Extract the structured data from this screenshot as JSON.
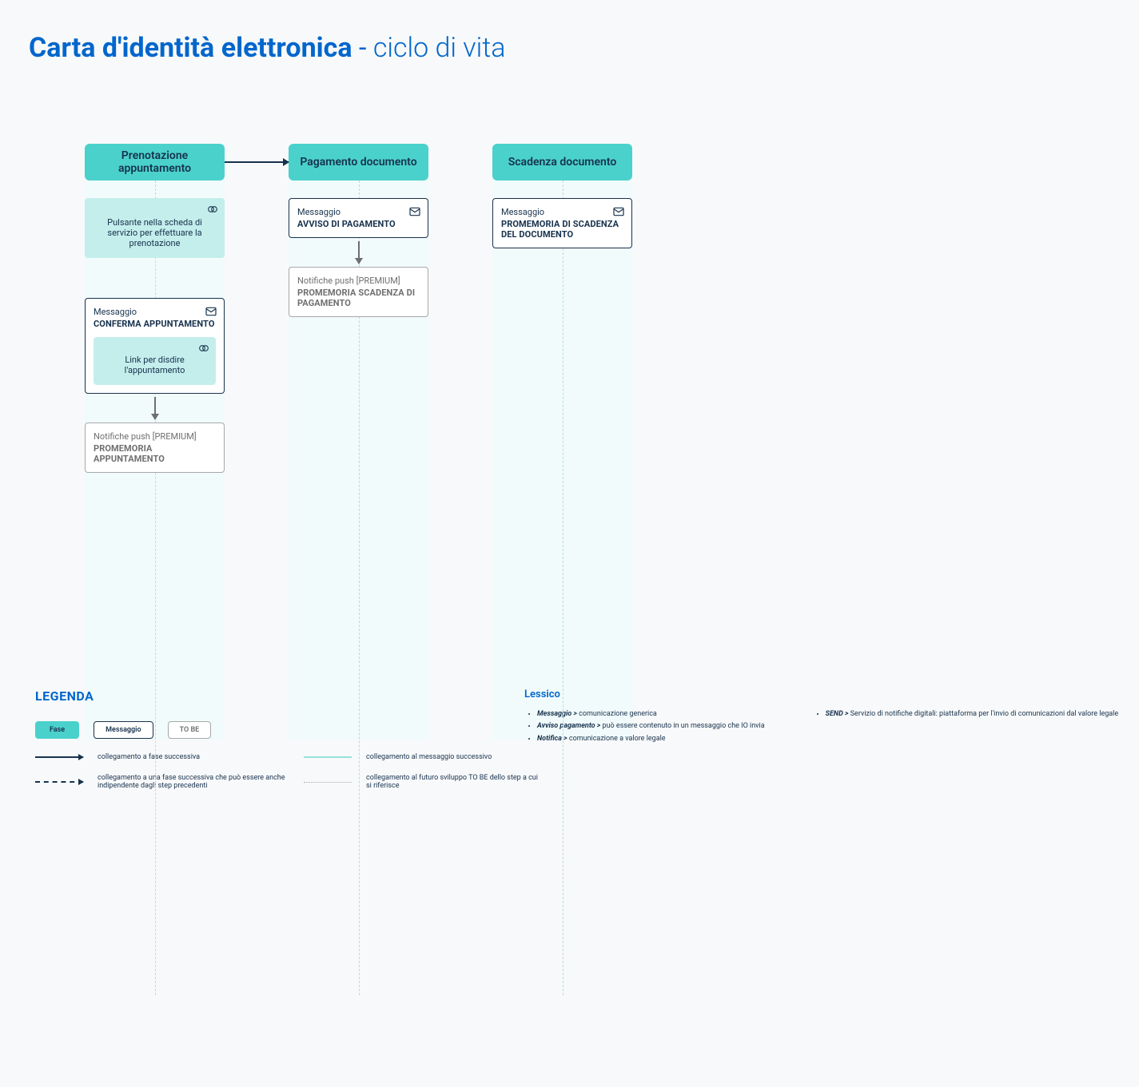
{
  "title": {
    "bold": "Carta d'identità elettronica",
    "sep": " - ",
    "light": "ciclo di vita"
  },
  "phases": [
    {
      "header": "Prenotazione appuntamento"
    },
    {
      "header": "Pagamento documento"
    },
    {
      "header": "Scadenza documento"
    }
  ],
  "col1": {
    "info1": "Pulsante nella scheda di servizio per effettuare la prenotazione",
    "msg1_label": "Messaggio",
    "msg1_name": "CONFERMA APPUNTAMENTO",
    "msg1_inner": "Link per disdire l'appuntamento",
    "push_label": "Notifiche push [PREMIUM]",
    "push_name": "PROMEMORIA APPUNTAMENTO"
  },
  "col2": {
    "msg_label": "Messaggio",
    "msg_name": "AVVISO DI PAGAMENTO",
    "push_label": "Notifiche push [PREMIUM]",
    "push_name": "PROMEMORIA SCADENZA DI PAGAMENTO"
  },
  "col3": {
    "msg_label": "Messaggio",
    "msg_name": "PROMEMORIA DI SCADENZA DEL DOCUMENTO"
  },
  "legend": {
    "title": "LEGENDA",
    "chip_phase": "Fase",
    "chip_msg": "Messaggio",
    "chip_tobe": "TO BE",
    "r1": "collegamento a fase successiva",
    "r2": "collegamento a una fase successiva che può essere anche indipendente dagli step precedenti",
    "r3": "collegamento al messaggio successivo",
    "r4": "collegamento al futuro sviluppo TO BE dello step a cui si riferisce"
  },
  "lexicon": {
    "title": "Lessico",
    "items_left": [
      {
        "term": "Messaggio >",
        "def": " comunicazione generica"
      },
      {
        "term": "Avviso pagamento >",
        "def": " può essere contenuto in un messaggio che IO invia"
      },
      {
        "term": "Notifica >",
        "def": " comunicazione a valore legale"
      }
    ],
    "items_right": [
      {
        "term": "SEND >",
        "def": " Servizio di notifiche digitali:  piattaforma per  l'invio di comunicazioni dal valore legale"
      }
    ]
  }
}
